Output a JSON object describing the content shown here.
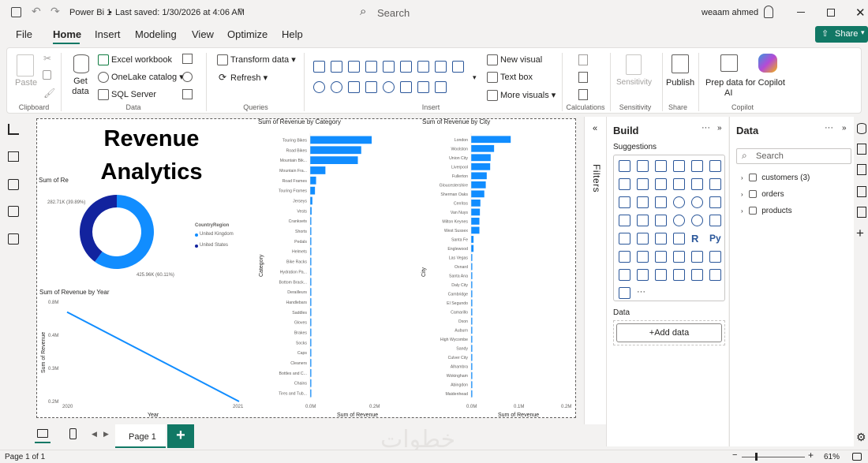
{
  "titlebar": {
    "app_title": "Power Bi 1",
    "saved": "Last saved: 1/30/2026 at 4:06 AM",
    "search": "Search",
    "user": "weaam ahmed"
  },
  "menu": [
    "File",
    "Home",
    "Insert",
    "Modeling",
    "View",
    "Optimize",
    "Help"
  ],
  "share": "Share",
  "ribbon": {
    "paste": "Paste",
    "get_data": "Get data",
    "excel": "Excel workbook",
    "onelake": "OneLake catalog",
    "sql": "SQL Server",
    "transform": "Transform data",
    "refresh": "Refresh",
    "new_visual": "New visual",
    "text_box": "Text box",
    "more_visuals": "More visuals",
    "sensitivity": "Sensitivity",
    "publish": "Publish",
    "prep": "Prep data for Copilot",
    "prep2": "AI",
    "groups": {
      "clipboard": "Clipboard",
      "data": "Data",
      "queries": "Queries",
      "insert": "Insert",
      "calculations": "Calculations",
      "sensitivity": "Sensitivity",
      "share": "Share",
      "copilot": "Copilot"
    }
  },
  "canvas": {
    "title_line1": "Revenue",
    "title_line2": "Analytics",
    "donut_title": "Sum of Re",
    "donut_label_a": "282.71K (39.89%)",
    "donut_label_b": "425.96K (60.11%)",
    "legend_title": "CountryRegion",
    "legend_uk": "United Kingdom",
    "legend_us": "United States",
    "colors": {
      "uk": "#118dff",
      "us": "#12239e"
    }
  },
  "chart_data": [
    {
      "type": "pie",
      "categories": [
        "United Kingdom",
        "United States"
      ],
      "values": [
        425960,
        282710
      ],
      "labels": [
        "425.96K (60.11%)",
        "282.71K (39.89%)"
      ]
    },
    {
      "type": "line",
      "title": "Sum of Revenue by Year",
      "xlabel": "Year",
      "ylabel": "Sum of Revenue",
      "x": [
        2020,
        2021
      ],
      "values": [
        0.74,
        0.2
      ],
      "ylim": [
        0.2,
        0.8
      ],
      "yticks": [
        "0.8M",
        "0.4M",
        "0.3M",
        "0.2M"
      ],
      "xticks": [
        "2020",
        "2021"
      ]
    },
    {
      "type": "bar",
      "title": "Sum of Revenue by Category",
      "xlabel": "Sum of Revenue",
      "ylabel": "Category",
      "xticks": [
        "0.0M",
        "0.2M"
      ],
      "xlim": [
        0,
        0.22
      ],
      "categories": [
        "Touring Bikes",
        "Road Bikes",
        "Mountain Bik...",
        "Mountain Fra...",
        "Road Frames",
        "Touring Frames",
        "Jerseys",
        "Vests",
        "Cranksets",
        "Shorts",
        "Pedals",
        "Helmets",
        "Bike Racks",
        "Hydration Pa...",
        "Bottom Brack...",
        "Derailleurs",
        "Handlebars",
        "Saddles",
        "Gloves",
        "Brakes",
        "Socks",
        "Caps",
        "Cleaners",
        "Bottles and C...",
        "Chains",
        "Tires and Tub..."
      ],
      "values": [
        0.165,
        0.137,
        0.128,
        0.041,
        0.016,
        0.013,
        0.006,
        0.004,
        0.003,
        0.003,
        0.002,
        0.002,
        0.002,
        0.002,
        0.002,
        0.002,
        0.001,
        0.001,
        0.001,
        0.001,
        0.001,
        0.001,
        0.001,
        0.001,
        0.001,
        0.001
      ]
    },
    {
      "type": "bar",
      "title": "Sum of Revenue by City",
      "xlabel": "Sum of Revenue",
      "ylabel": "City",
      "xticks": [
        "0.0M",
        "0.1M",
        "0.2M"
      ],
      "xlim": [
        0,
        0.2
      ],
      "categories": [
        "London",
        "Woolston",
        "Union City",
        "Liverpool",
        "Fullerton",
        "Gloucestershire",
        "Sherman Oaks",
        "Cerritos",
        "Van Nuys",
        "Milton Keynes",
        "West Sussex",
        "Santa Fe",
        "Englewood",
        "Las Vegas",
        "Oxnard",
        "Santa Ana",
        "Daly City",
        "Cambridge",
        "El Segundo",
        "Camarillo",
        "Oxon",
        "Auburn",
        "High Wycombe",
        "Sandy",
        "Culver City",
        "Alhambra",
        "Wokingham",
        "Abingdon",
        "Maidenhead"
      ],
      "values": [
        0.081,
        0.047,
        0.04,
        0.039,
        0.032,
        0.03,
        0.027,
        0.019,
        0.018,
        0.017,
        0.017,
        0.005,
        0.005,
        0.002,
        0.002,
        0.002,
        0.002,
        0.001,
        0.001,
        0.001,
        0.001,
        0.001,
        0.001,
        0.001,
        0.001,
        0.001,
        0.001,
        0.001,
        0.001
      ]
    }
  ],
  "build": {
    "title": "Build",
    "suggestions": "Suggestions",
    "data": "Data",
    "add_data": "+Add data",
    "filters": "Filters",
    "r": "R",
    "py": "Py"
  },
  "datapane": {
    "title": "Data",
    "search": "Search",
    "tables": [
      "customers (3)",
      "orders",
      "products"
    ]
  },
  "pagebar": {
    "page": "Page 1"
  },
  "status": {
    "page": "Page 1 of 1",
    "zoom": "61%"
  },
  "watermark": "خطوات"
}
